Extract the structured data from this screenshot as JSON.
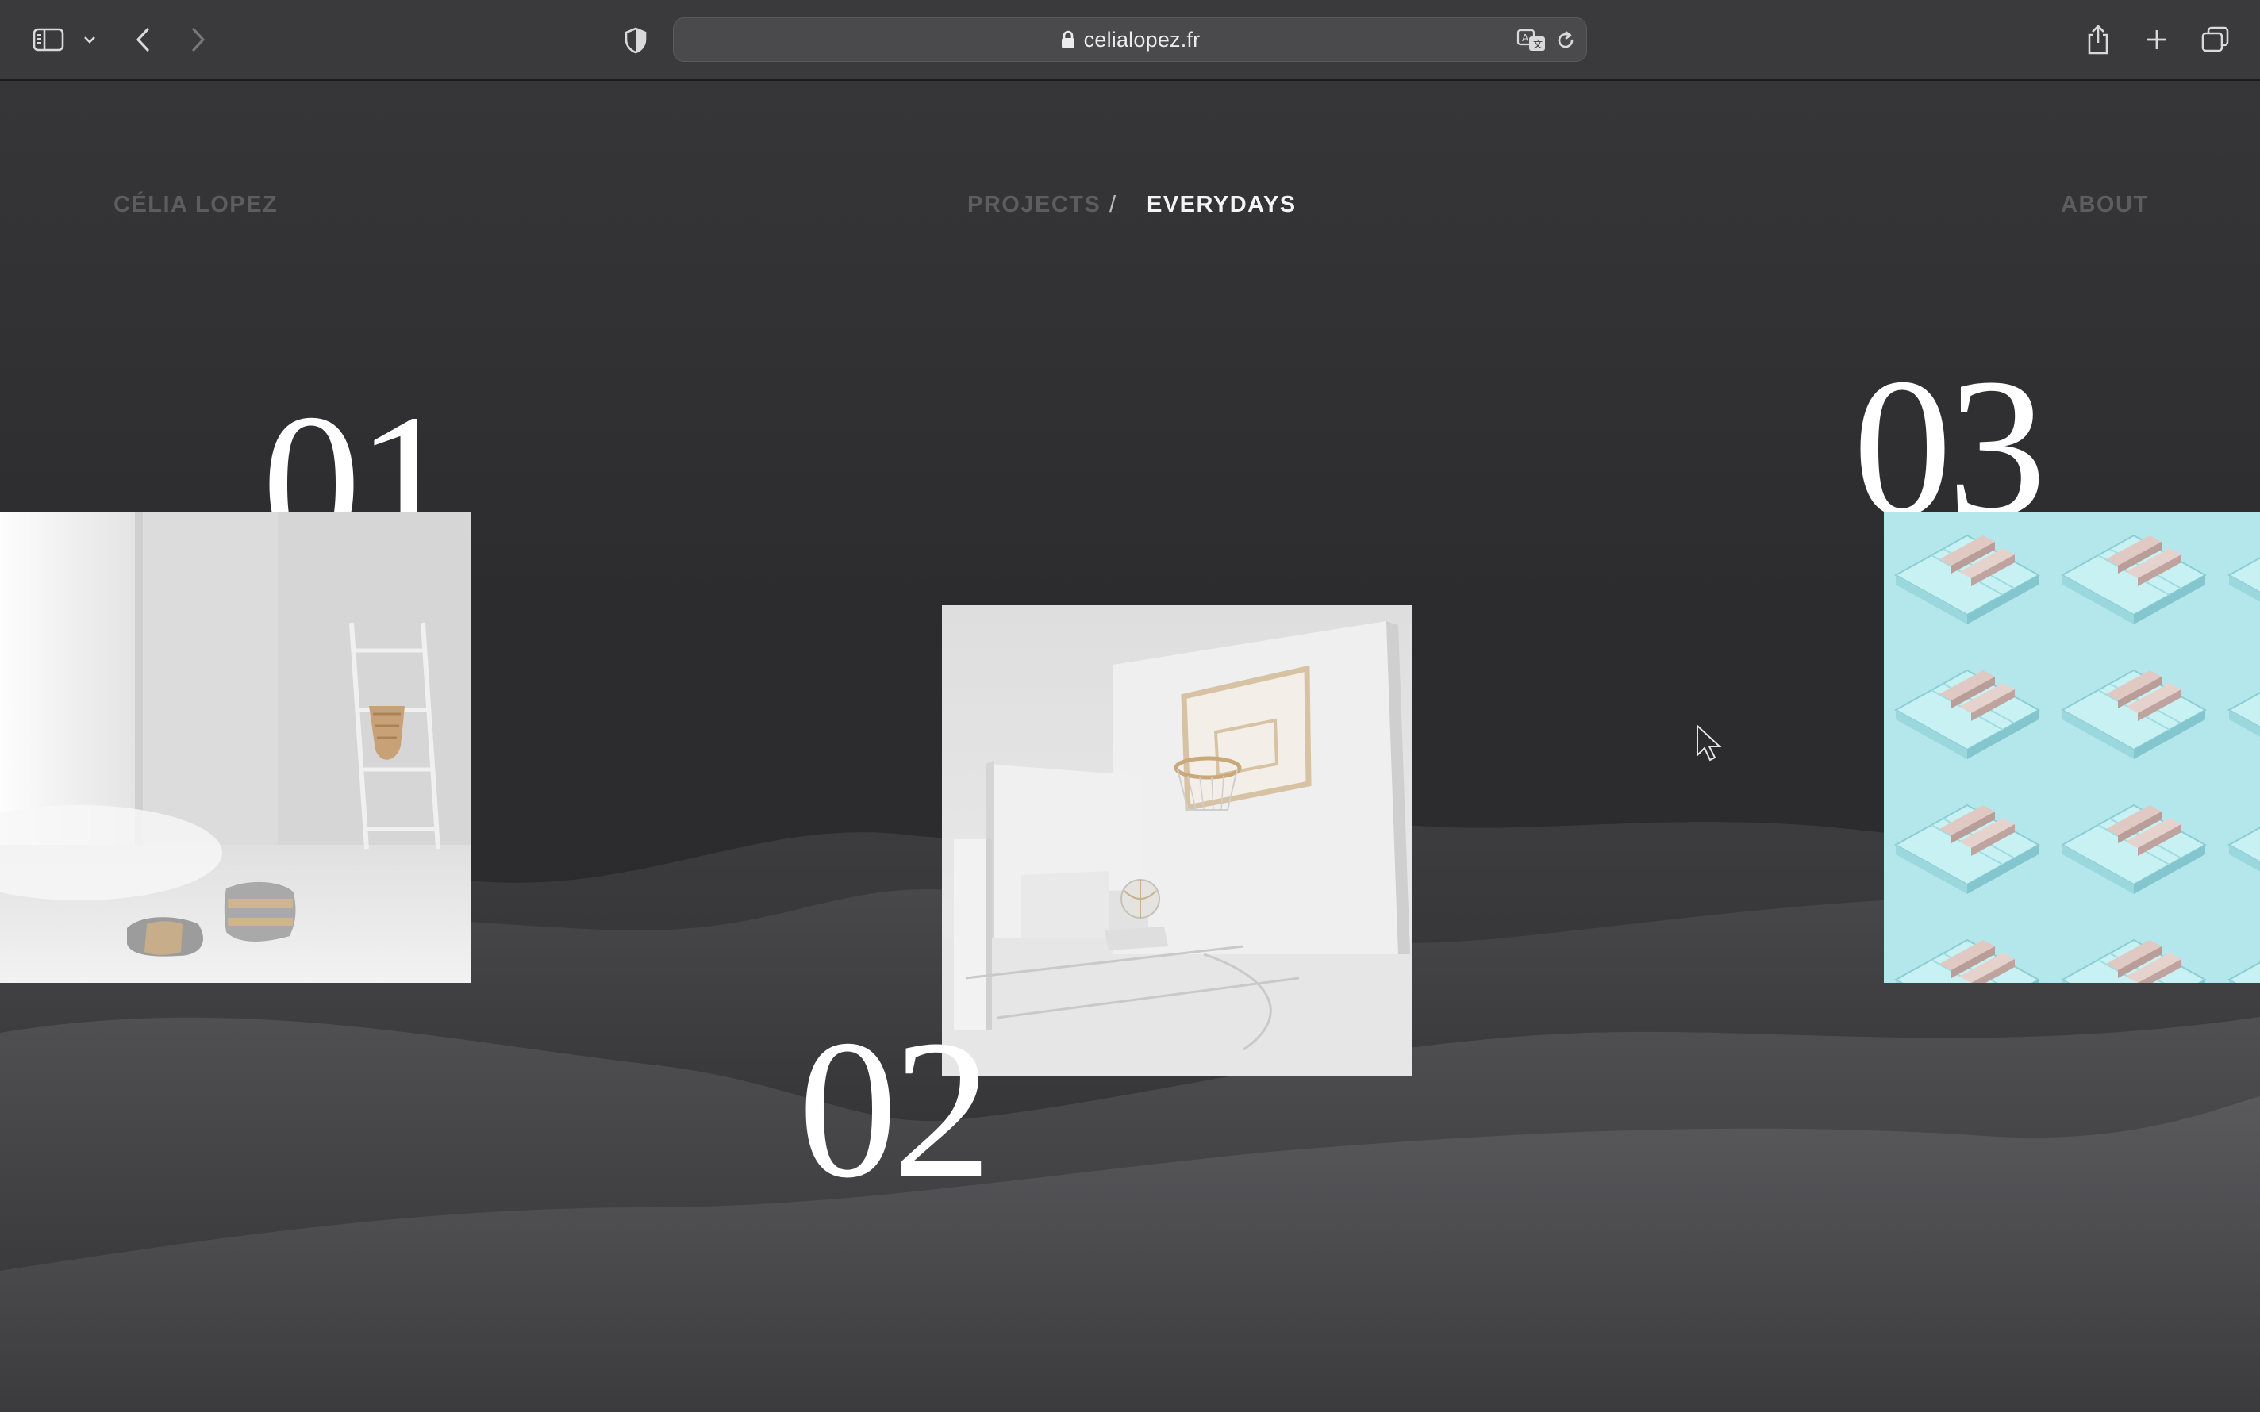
{
  "browser": {
    "url": "celialopez.fr",
    "icons": {
      "sidebar": "sidebar-icon",
      "back": "chevron-left-icon",
      "forward": "chevron-right-icon",
      "privacy": "shield-icon",
      "lock": "lock-icon",
      "translate": "translate-icon",
      "reload": "reload-icon",
      "share": "share-icon",
      "new_tab": "plus-icon",
      "tabs": "tabs-overview-icon"
    }
  },
  "site": {
    "brand": "CÉLIA LOPEZ",
    "nav": {
      "projects": "PROJECTS",
      "separator": "/",
      "everydays": "EVERYDAYS",
      "about": "ABOUT"
    },
    "active_nav": "EVERYDAYS"
  },
  "everydays": [
    {
      "number": "01",
      "subject": "white room with ladder, hanging basket and cushions"
    },
    {
      "number": "02",
      "subject": "white room with basketball hoop and ball"
    },
    {
      "number": "03",
      "subject": "isometric pattern of pale blue blocks with pink bars"
    }
  ],
  "colors": {
    "background": "#2b2b2d",
    "nav_inactive": "#5d5d60",
    "nav_active": "#f4f4f6",
    "numbers": "#ffffff",
    "tile_03_base": "#b4e7ec"
  }
}
